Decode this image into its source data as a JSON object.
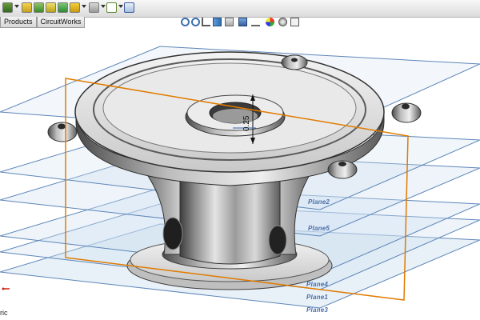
{
  "tabs": [
    {
      "label": "Products"
    },
    {
      "label": "CircuitWorks"
    }
  ],
  "toolbar": {
    "icons": [
      "feature-icon",
      "sketch-icon",
      "insert-icon",
      "extrude-icon",
      "cut-icon",
      "fillet-icon",
      "pattern-icon",
      "curve-icon",
      "reference-geometry-icon",
      "view-settings-icon"
    ]
  },
  "view_toolbar": {
    "icons": [
      "zoom-to-fit-icon",
      "zoom-to-area-icon",
      "previous-view-icon",
      "section-view-icon",
      "view-orientation-icon",
      "display-style-icon",
      "hide-show-icon",
      "edit-appearance-icon",
      "apply-scene-icon",
      "view-settings-icon"
    ]
  },
  "model": {
    "dimension_text": "0.25"
  },
  "planes": [
    {
      "label": "Plane2"
    },
    {
      "label": "Plane5"
    },
    {
      "label": "Plane4"
    },
    {
      "label": "Plane1"
    },
    {
      "label": "Plane3"
    }
  ],
  "status": {
    "view_label": "ric"
  },
  "colors": {
    "plane_fill": "#cfe0f0",
    "plane_edge": "#5d86b8",
    "sketch_plane": "#e07b00",
    "part_metal": "#b9b9b9",
    "plane_label": "#4b6ea8"
  }
}
